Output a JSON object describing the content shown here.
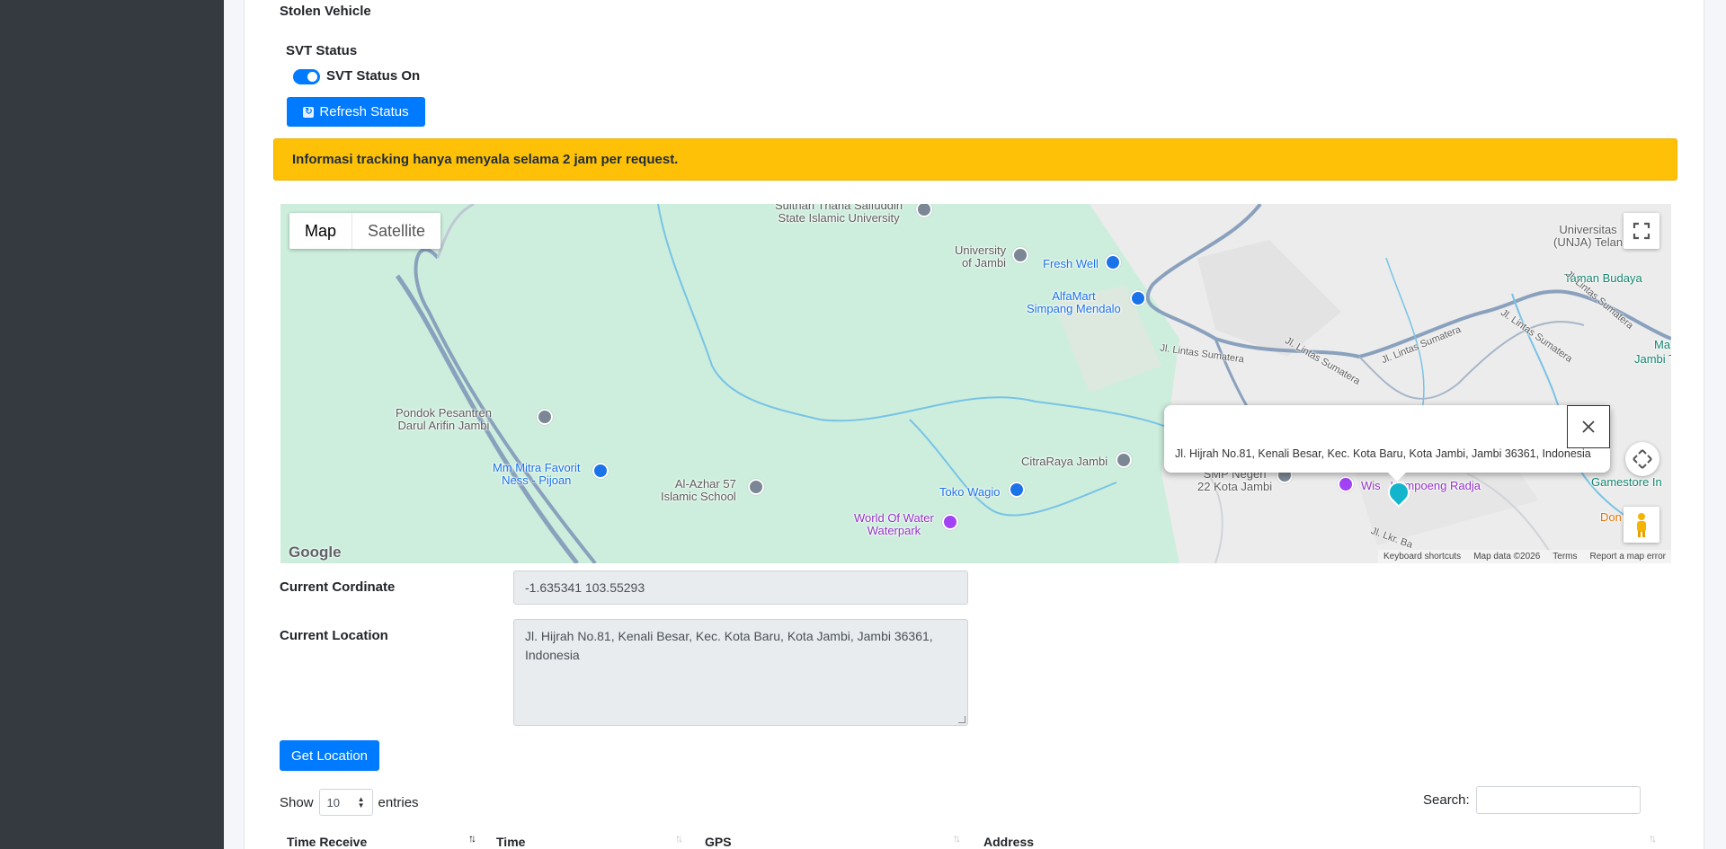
{
  "section": {
    "title": "Stolen Vehicle"
  },
  "svt": {
    "title": "SVT Status",
    "toggle_label": "SVT Status On",
    "toggle_on": true,
    "refresh_label": "Refresh Status"
  },
  "alert": {
    "text": "Informasi tracking hanya menyala selama 2 jam per request."
  },
  "map": {
    "type_map": "Map",
    "type_satellite": "Satellite",
    "info_address": "Jl. Hijrah No.81, Kenali Besar, Kec. Kota Baru, Kota Jambi, Jambi 36361, Indonesia",
    "google_logo": "Google",
    "footer": {
      "shortcuts": "Keyboard shortcuts",
      "data": "Map data ©2026",
      "terms": "Terms",
      "report": "Report a map error"
    },
    "labels": {
      "sulthan": "Sulthan Thaha Saifuddin\nState Islamic University",
      "univ_jambi": "University\nof Jambi",
      "fresh_well": "Fresh Well",
      "alfamart": "AlfaMart\nSimpang Mendalo",
      "unja": "Universitas\n(UNJA) Telan",
      "taman": "Taman Budaya",
      "jambi_to": "Jambi To",
      "ma": "Ma",
      "pondok": "Pondok Pesantren\nDarul Arifin Jambi",
      "mm_mitra": "Mm Mitra Favorit\nNess - Pijoan",
      "al_azhar": "Al-Azhar 57\nIslamic School",
      "toko_wagio": "Toko Wagio",
      "world_water": "World Of Water\nWaterpark",
      "citraraya": "CitraRaya Jambi",
      "smp": "SMP Negeri\n22 Kota Jambi",
      "kampoeng": "Wis   Kampoeng Radja",
      "gamestore": "Gamestore In",
      "don": "Don",
      "jl_lkr": "Jl. Lkr. Ba",
      "road1": "Jl. Lintas Sumatera",
      "road2": "Jl. Lintas Sumatera",
      "road3": "Jl. Lintas Sumatera",
      "road4": "Jl. Lintas Sumatera",
      "road5": "Jl. Lintas Sumatera"
    }
  },
  "form": {
    "coord_label": "Current Cordinate",
    "coord_value": "-1.635341 103.55293",
    "location_label": "Current Location",
    "location_value": "Jl. Hijrah No.81, Kenali Besar, Kec. Kota Baru, Kota Jambi, Jambi 36361, Indonesia",
    "get_location_label": "Get Location"
  },
  "datatable": {
    "show_label": "Show",
    "page_size": "10",
    "entries_label": "entries",
    "search_label": "Search:",
    "columns": [
      "Time Receive",
      "Time",
      "GPS",
      "Address"
    ]
  },
  "colors": {
    "primary": "#007bff",
    "warning": "#ffc107",
    "sidebar": "#343a40"
  }
}
